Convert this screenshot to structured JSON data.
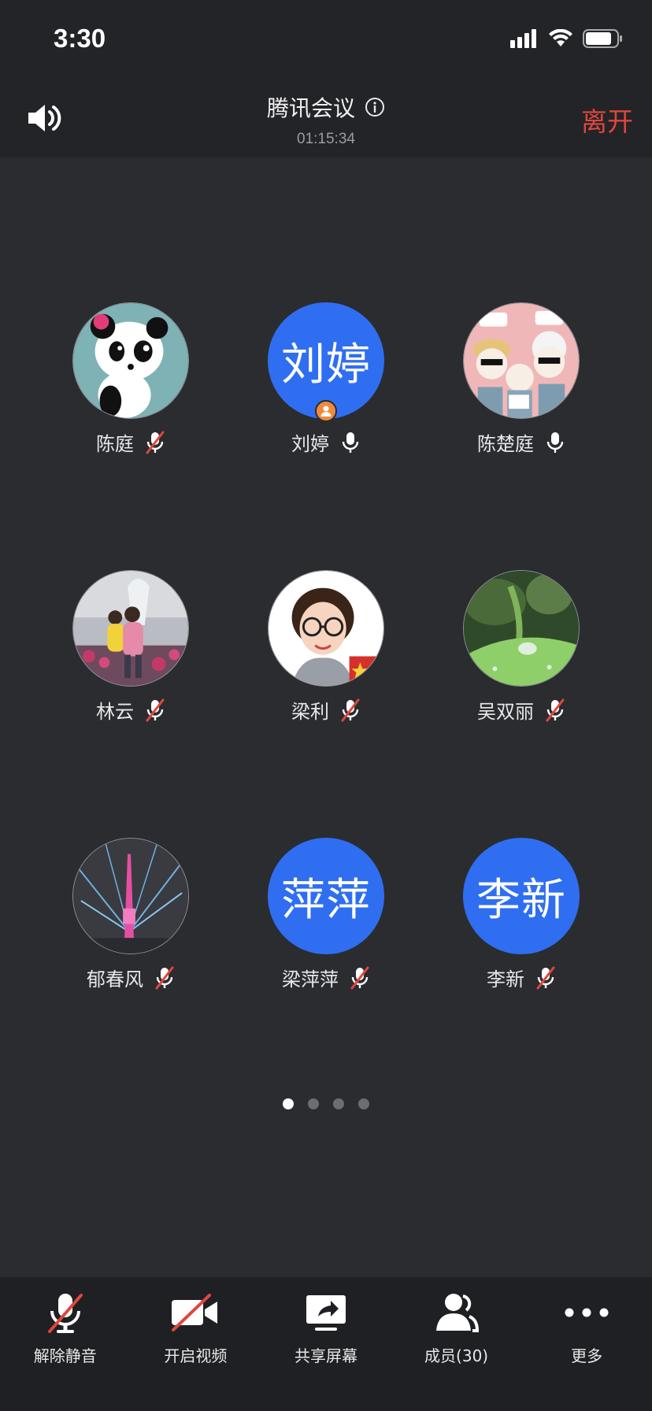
{
  "status": {
    "time": "3:30"
  },
  "header": {
    "title": "腾讯会议",
    "timer": "01:15:34",
    "leave": "离开"
  },
  "participants": [
    {
      "name": "陈庭",
      "mic": "muted"
    },
    {
      "name": "刘婷",
      "avatar_text": "刘婷",
      "mic": "on",
      "host": true
    },
    {
      "name": "陈楚庭",
      "mic": "on"
    },
    {
      "name": "林云",
      "mic": "muted"
    },
    {
      "name": "梁利",
      "mic": "muted"
    },
    {
      "name": "吴双丽",
      "mic": "muted"
    },
    {
      "name": "郁春风",
      "mic": "muted"
    },
    {
      "name": "梁萍萍",
      "avatar_text": "萍萍",
      "mic": "muted"
    },
    {
      "name": "李新",
      "avatar_text": "李新",
      "mic": "muted"
    }
  ],
  "pagination": {
    "pages": 4,
    "current": 1
  },
  "toolbar": {
    "unmute": "解除静音",
    "video": "开启视频",
    "share": "共享屏幕",
    "members": "成员(30)",
    "more": "更多"
  },
  "colors": {
    "accent_blue": "#2f6ef0",
    "leave_red": "#e0463e",
    "mute_red": "#e0463e",
    "host_orange": "#f08a3a"
  }
}
